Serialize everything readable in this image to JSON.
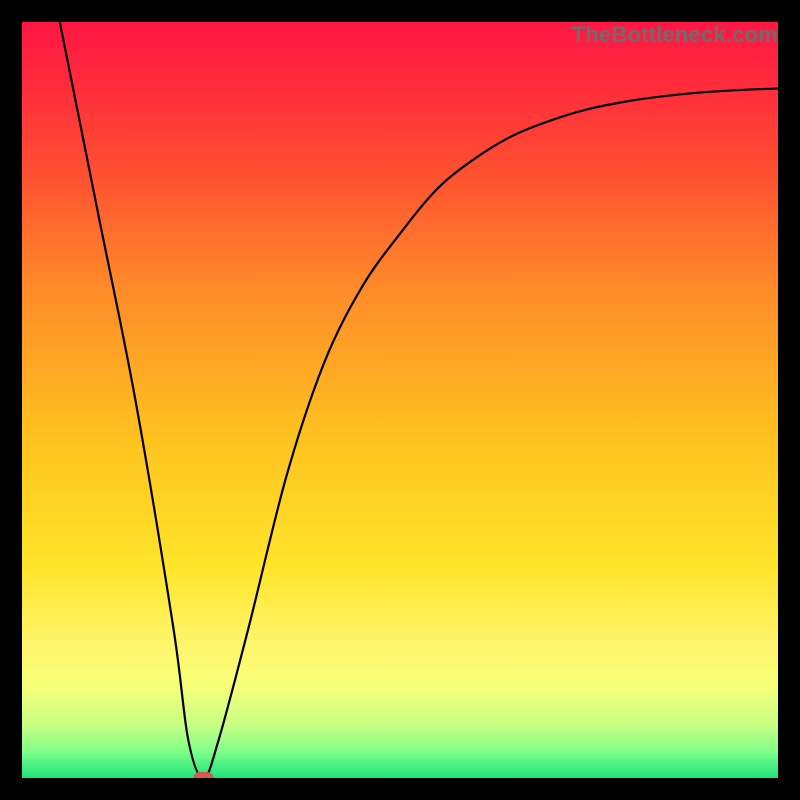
{
  "watermark": "TheBottleneck.com",
  "chart_data": {
    "type": "line",
    "title": "",
    "xlabel": "",
    "ylabel": "",
    "xlim": [
      0,
      100
    ],
    "ylim": [
      0,
      100
    ],
    "grid": false,
    "legend": false,
    "background": "red-yellow-green vertical gradient",
    "series": [
      {
        "name": "bottleneck-curve",
        "x": [
          5,
          10,
          15,
          20,
          22,
          24,
          26,
          30,
          35,
          40,
          45,
          50,
          55,
          60,
          65,
          70,
          75,
          80,
          85,
          90,
          95,
          100
        ],
        "y": [
          100,
          75,
          50,
          20,
          5,
          0,
          5,
          20,
          40,
          55,
          65,
          72,
          78,
          82,
          85,
          87,
          88.5,
          89.5,
          90.2,
          90.7,
          91,
          91.2
        ]
      }
    ],
    "marker": {
      "name": "optimum",
      "x": 24,
      "y": 0,
      "color": "#d35c4a",
      "shape": "rounded-rect"
    },
    "gradient_stops": [
      {
        "pos": 0.0,
        "color": "#ff1744"
      },
      {
        "pos": 0.08,
        "color": "#ff2a3c"
      },
      {
        "pos": 0.2,
        "color": "#ff5030"
      },
      {
        "pos": 0.35,
        "color": "#ff8a2a"
      },
      {
        "pos": 0.55,
        "color": "#ffc21f"
      },
      {
        "pos": 0.72,
        "color": "#ffe42a"
      },
      {
        "pos": 0.82,
        "color": "#fff56a"
      },
      {
        "pos": 0.88,
        "color": "#f6ff7a"
      },
      {
        "pos": 0.93,
        "color": "#c7ff82"
      },
      {
        "pos": 0.965,
        "color": "#7fff8a"
      },
      {
        "pos": 1.0,
        "color": "#1de37a"
      }
    ]
  }
}
